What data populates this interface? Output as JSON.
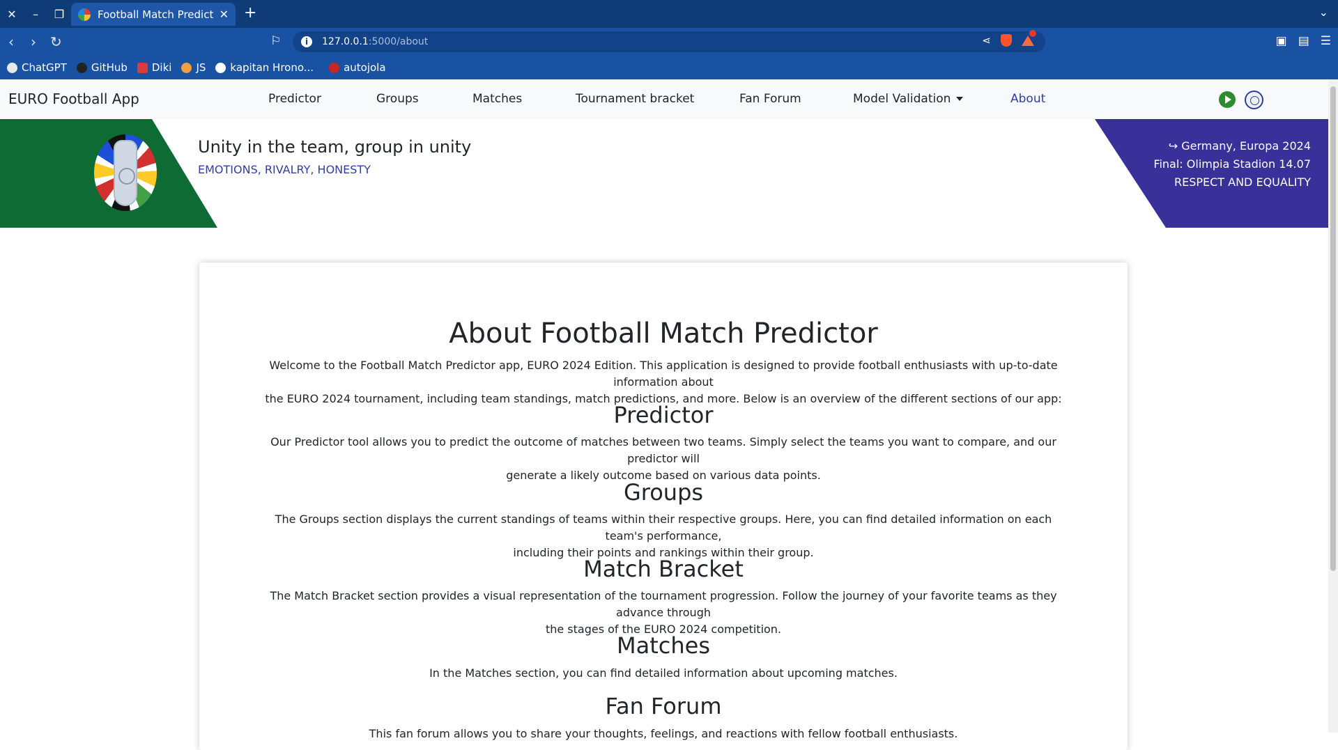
{
  "browser": {
    "tab_title": "Football Match Predictor",
    "url_host": "127.0.0.1",
    "url_path": ":5000/about",
    "bookmarks": [
      "ChatGPT",
      "GitHub",
      "Diki",
      "JS",
      "kapitan Hrono...",
      "autojola"
    ]
  },
  "nav": {
    "brand": "EURO Football App",
    "items": [
      "Predictor",
      "Groups",
      "Matches",
      "Tournament bracket",
      "Fan Forum",
      "Model Validation",
      "About"
    ],
    "active": "About"
  },
  "banner": {
    "title": "Unity in the team, group in unity",
    "subtitle": "EMOTIONS, RIVALRY, HONESTY",
    "right_line1": "↪ Germany, Europa 2024",
    "right_line2": "Final: Olimpia Stadion 14.07",
    "right_line3": "RESPECT AND EQUALITY"
  },
  "about": {
    "title": "About Football Match Predictor",
    "intro_1": "Welcome to the Football Match Predictor app, EURO 2024 Edition. This application is designed to provide football enthusiasts with up-to-date information about",
    "intro_2": "the EURO 2024 tournament, including team standings, match predictions, and more. Below is an overview of the different sections of our app:",
    "sections": [
      {
        "title": "Predictor",
        "line1": "Our Predictor tool allows you to predict the outcome of matches between two teams. Simply select the teams you want to compare, and our predictor will",
        "line2": "generate a likely outcome based on various data points."
      },
      {
        "title": "Groups",
        "line1": "The Groups section displays the current standings of teams within their respective groups. Here, you can find detailed information on each team's performance,",
        "line2": "including their points and rankings within their group."
      },
      {
        "title": "Match Bracket",
        "line1": "The Match Bracket section provides a visual representation of the tournament progression. Follow the journey of your favorite teams as they advance through",
        "line2": "the stages of the EURO 2024 competition."
      },
      {
        "title": "Matches",
        "line1": "In the Matches section, you can find detailed information about upcoming matches."
      },
      {
        "title": "Fan Forum",
        "line1": "This fan forum allows you to share your thoughts, feelings, and reactions with fellow football enthusiasts."
      }
    ]
  }
}
